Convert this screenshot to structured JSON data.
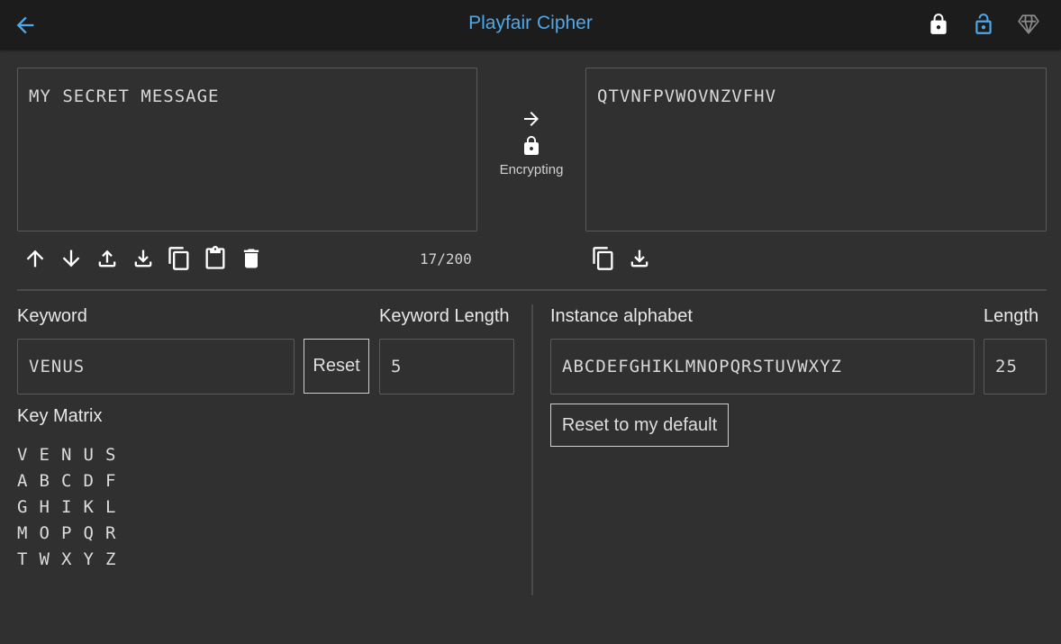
{
  "app": {
    "title": "Playfair Cipher",
    "accent_color": "#4fa8e8",
    "icons": [
      "back-arrow-icon",
      "lock-icon",
      "unlock-icon",
      "diamond-icon"
    ]
  },
  "input": {
    "text": "MY SECRET MESSAGE",
    "counter": "17/200",
    "toolbar_icons": [
      "arrow-up-icon",
      "arrow-down-icon",
      "upload-icon",
      "download-icon",
      "copy-icon",
      "paste-icon",
      "delete-icon"
    ]
  },
  "mode": {
    "label": "Encrypting",
    "icons": [
      "arrow-right-icon",
      "lock-icon"
    ]
  },
  "output": {
    "text": "QTVNFPVWOVNZVFHV",
    "toolbar_icons": [
      "copy-icon",
      "download-icon"
    ]
  },
  "keyword": {
    "label": "Keyword",
    "value": "VENUS",
    "reset_label": "Reset",
    "length_label": "Keyword Length",
    "length_value": "5"
  },
  "alphabet": {
    "label": "Instance alphabet",
    "value": "ABCDEFGHIKLMNOPQRSTUVWXYZ",
    "length_label": "Length",
    "length_value": "25",
    "reset_label": "Reset to my default"
  },
  "matrix": {
    "label": "Key Matrix",
    "rows": [
      [
        "V",
        "E",
        "N",
        "U",
        "S"
      ],
      [
        "A",
        "B",
        "C",
        "D",
        "F"
      ],
      [
        "G",
        "H",
        "I",
        "K",
        "L"
      ],
      [
        "M",
        "O",
        "P",
        "Q",
        "R"
      ],
      [
        "T",
        "W",
        "X",
        "Y",
        "Z"
      ]
    ]
  }
}
